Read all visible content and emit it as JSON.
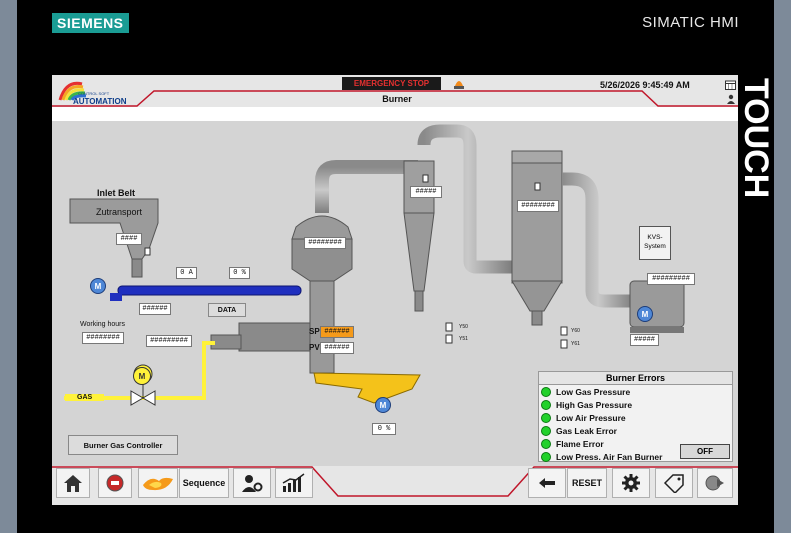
{
  "device": {
    "brand": "SIEMENS",
    "model": "SIMATIC HMI",
    "side_label": "TOUCH"
  },
  "header": {
    "logo_text": "AUTOMATION",
    "logo_subtext": "CONTROL SOFT",
    "emergency_stop": "EMERGENCY STOP",
    "title": "Burner",
    "datetime": "5/26/2026 9:45:49 AM"
  },
  "process": {
    "inlet_belt_label": "Inlet Belt",
    "zutransport_label": "Zutransport",
    "current": "0 A",
    "speed_pct": "0 %",
    "data_button": "DATA",
    "working_hours_label": "Working hours",
    "kvs_label": "KVS-System",
    "sp_label": "SP",
    "pv_label": "PV",
    "gas_label": "GAS",
    "burner_fan_pct": "0 %",
    "burner_gas_controller": "Burner Gas Controller",
    "motor_label": "M",
    "valves": [
      "Y50",
      "Y51",
      "Y60",
      "Y61"
    ],
    "placeholder4": "####",
    "placeholder5": "#####",
    "placeholder6": "######",
    "placeholder8": "########",
    "placeholder9": "#########"
  },
  "errors": {
    "title": "Burner Errors",
    "items": [
      "Low Gas Pressure",
      "High Gas Pressure",
      "Low Air Pressure",
      "Gas Leak Error",
      "Flame Error",
      "Low Press. Air Fan Burner"
    ],
    "status_colors": {
      "ok": "#22d12b"
    },
    "off_button": "OFF"
  },
  "navbar": {
    "sequence": "Sequence",
    "reset": "RESET",
    "icons": [
      "home-icon",
      "stop-icon",
      "flame-icon",
      "user-settings-icon",
      "trend-icon",
      "back-arrow-icon",
      "gear-icon",
      "tag-icon",
      "exit-icon"
    ]
  },
  "colors": {
    "accent_red": "#c0162a",
    "gas_yellow": "#fff23a",
    "belt_blue": "#1f2fbf"
  }
}
